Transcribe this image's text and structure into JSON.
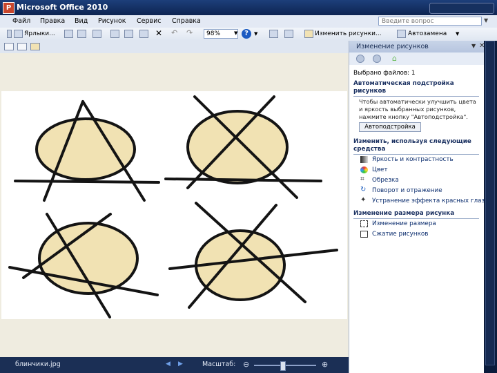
{
  "window": {
    "title": "Microsoft Office 2010",
    "app_icon_letter": "P"
  },
  "menu": {
    "items": [
      "Файл",
      "Правка",
      "Вид",
      "Рисунок",
      "Сервис",
      "Справка"
    ],
    "help_placeholder": "Введите вопрос"
  },
  "toolbar": {
    "shortcuts_label": "Ярлыки...",
    "zoom_value": "98%",
    "edit_pictures_label": "Изменить рисунки...",
    "autocorrect_label": "Автозамена"
  },
  "status": {
    "file_name": "блинчики.jpg",
    "scale_label": "Масштаб:"
  },
  "task_pane": {
    "title": "Изменение рисунков",
    "selected_files": "Выбрано файлов: 1",
    "auto_section": {
      "heading_1": "Автоматическая подстройка",
      "heading_2": "рисунков",
      "desc_1": "Чтобы автоматически улучшить цвета",
      "desc_2": "и яркость выбранных рисунков,",
      "desc_3": "нажмите кнопку \"Автоподстройка\".",
      "button": "Автоподстройка"
    },
    "tools_section": {
      "heading_1": "Изменить, используя следующие",
      "heading_2": "средства",
      "links": [
        {
          "label": "Яркость и контрастность",
          "icon": "brightness-icon"
        },
        {
          "label": "Цвет",
          "icon": "color-icon"
        },
        {
          "label": "Обрезка",
          "icon": "crop-icon"
        },
        {
          "label": "Поворот и отражение",
          "icon": "rotate-icon"
        },
        {
          "label": "Устранение эффекта красных глаз",
          "icon": "red-eye-icon"
        }
      ]
    },
    "resize_section": {
      "heading": "Изменение размера рисунка",
      "links": [
        {
          "label": "Изменение размера",
          "icon": "resize-icon"
        },
        {
          "label": "Сжатие рисунков",
          "icon": "compress-icon"
        }
      ]
    }
  },
  "colors": {
    "pancake_fill": "#f1e2b3",
    "stroke": "#141414",
    "titlebar": "#13306a"
  }
}
